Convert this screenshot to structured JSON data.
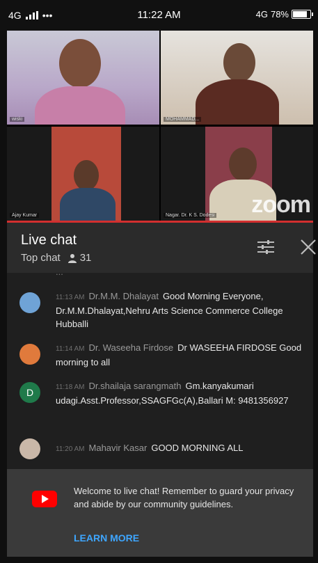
{
  "status_bar": {
    "network": "4G",
    "dots": "•••",
    "time": "11:22 AM",
    "right_network": "4G",
    "battery": "78%"
  },
  "video": {
    "participants": [
      {
        "name": "wiski"
      },
      {
        "name": "MOHAMMAD..."
      },
      {
        "name": "Ajay Kumar"
      },
      {
        "name": "Nagar. Dr. K S. Dodesi"
      }
    ],
    "logo": "zoom"
  },
  "chat": {
    "title": "Live chat",
    "mode": "Top chat",
    "viewer_count": "31",
    "cut_line": "...",
    "messages": [
      {
        "time": "11:13 AM",
        "author": "Dr.M.M. Dhalayat",
        "text": "Good Morning Everyone, Dr.M.M.Dhalayat,Nehru Arts Science Commerce College Hubballi",
        "avatar_color": "#6fa3d6"
      },
      {
        "time": "11:14 AM",
        "author": "Dr. Waseeha Firdose",
        "text": "Dr WASEEHA FIRDOSE Good morning to all",
        "avatar_color": "#e07a3c"
      },
      {
        "time": "11:18 AM",
        "author": "Dr.shailaja sarangmath",
        "text": "Gm.kanyakumari udagi.Asst.Professor,SSAGFGc(A),Ballari M: 9481356927",
        "avatar_color": "#1f7a4a",
        "avatar_letter": "D"
      },
      {
        "time": "11:20 AM",
        "author": "Mahavir Kasar",
        "text": "GOOD MORNING ALL",
        "avatar_color": "#c9b7a8"
      }
    ]
  },
  "welcome": {
    "text": "Welcome to live chat! Remember to guard your privacy and abide by our community guidelines.",
    "link": "LEARN MORE"
  }
}
